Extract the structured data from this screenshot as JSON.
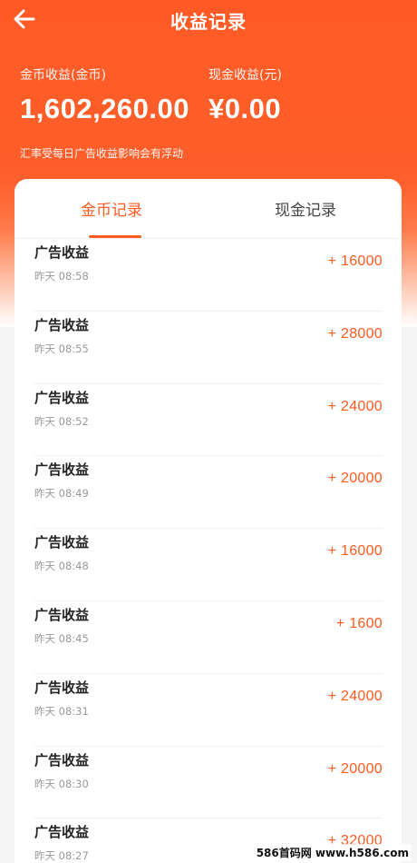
{
  "header": {
    "title": "收益记录",
    "back_icon": "back-arrow-icon"
  },
  "balances": {
    "coin_label": "金币收益(金币)",
    "coin_value": "1,602,260.00",
    "cash_label": "现金收益(元)",
    "cash_value": "¥0.00",
    "note": "汇率受每日广告收益影响会有浮动"
  },
  "tabs": {
    "coin_records": "金币记录",
    "cash_records": "现金记录",
    "active": "coin_records"
  },
  "records": [
    {
      "title": "广告收益",
      "time": "昨天 08:58",
      "amount": "+ 16000"
    },
    {
      "title": "广告收益",
      "time": "昨天 08:55",
      "amount": "+ 28000"
    },
    {
      "title": "广告收益",
      "time": "昨天 08:52",
      "amount": "+ 24000"
    },
    {
      "title": "广告收益",
      "time": "昨天 08:49",
      "amount": "+ 20000"
    },
    {
      "title": "广告收益",
      "time": "昨天 08:48",
      "amount": "+ 16000"
    },
    {
      "title": "广告收益",
      "time": "昨天 08:45",
      "amount": "+ 1600"
    },
    {
      "title": "广告收益",
      "time": "昨天 08:31",
      "amount": "+ 24000"
    },
    {
      "title": "广告收益",
      "time": "昨天 08:30",
      "amount": "+ 20000"
    },
    {
      "title": "广告收益",
      "time": "昨天 08:27",
      "amount": "+ 32000"
    }
  ],
  "watermark": "586首码网 www.h586.com",
  "colors": {
    "accent": "#ff5a1f",
    "header_bg": "#ff5a26"
  }
}
